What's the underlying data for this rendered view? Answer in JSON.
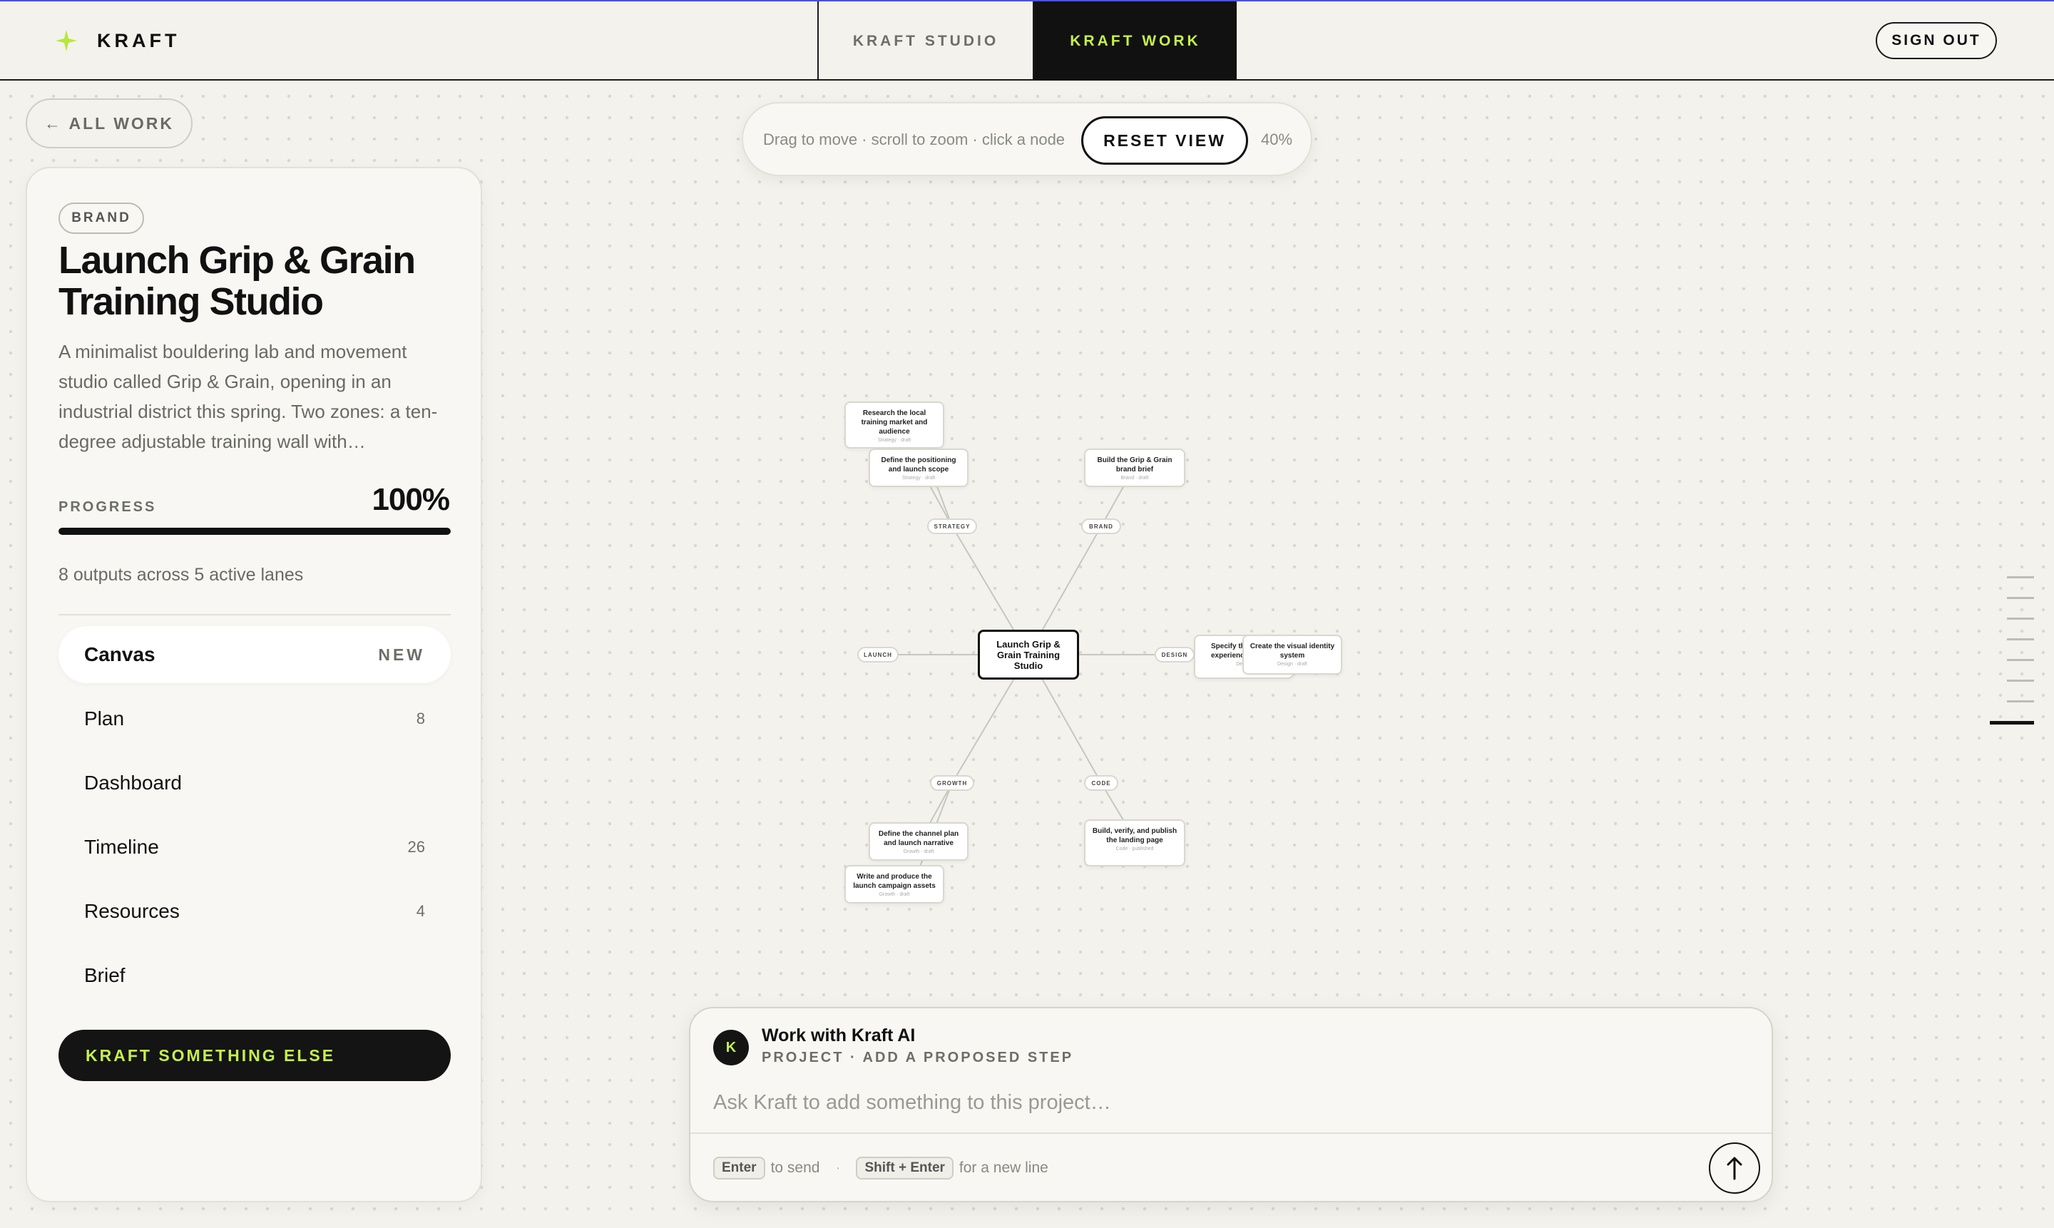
{
  "header": {
    "brand": "KRAFT",
    "tabs": [
      {
        "label": "KRAFT STUDIO",
        "active": false
      },
      {
        "label": "KRAFT WORK",
        "active": true
      }
    ],
    "sign_out": "SIGN OUT"
  },
  "back_link": "← ALL WORK",
  "project": {
    "tag": "BRAND",
    "title": "Launch Grip & Grain Training Studio",
    "description": "A minimalist bouldering lab and movement studio called Grip & Grain, opening in an industrial district this spring. Two zones: a ten-degree adjustable training wall with…",
    "progress_label": "PROGRESS",
    "progress_value": "100%",
    "progress_fraction": 1.0,
    "outputs_summary": "8 outputs across 5 active lanes",
    "nav": [
      {
        "label": "Canvas",
        "badge": "NEW",
        "active": true
      },
      {
        "label": "Plan",
        "count": "8"
      },
      {
        "label": "Dashboard",
        "count": ""
      },
      {
        "label": "Timeline",
        "count": "26"
      },
      {
        "label": "Resources",
        "count": "4"
      },
      {
        "label": "Brief",
        "count": ""
      }
    ],
    "cta": "KRAFT SOMETHING ELSE"
  },
  "toolbar": {
    "hint": "Drag to move · scroll to zoom · click a node",
    "reset": "RESET VIEW",
    "zoom": "40%"
  },
  "canvas": {
    "center": "Launch Grip & Grain Training Studio",
    "lanes": {
      "strategy": "STRATEGY",
      "brand": "BRAND",
      "launch": "LAUNCH",
      "design": "DESIGN",
      "growth": "GROWTH",
      "code": "CODE"
    },
    "nodes": {
      "research": {
        "title": "Research the local training market and audience",
        "sub": "Strategy · draft"
      },
      "positioning": {
        "title": "Define the positioning and launch scope",
        "sub": "Strategy · draft"
      },
      "brand_brief": {
        "title": "Build the Grip & Grain brand brief",
        "sub": "Brand · draft"
      },
      "booking": {
        "title": "Specify the page experience booking",
        "sub": "Design"
      },
      "identity": {
        "title": "Create the visual identity system",
        "sub": "Design · draft"
      },
      "channel": {
        "title": "Define the channel plan and launch narrative",
        "sub": "Growth · draft"
      },
      "campaign": {
        "title": "Write and produce the launch campaign assets",
        "sub": "Growth · draft"
      },
      "landing": {
        "title": "Build, verify, and publish the landing page",
        "sub": "Code · published"
      }
    }
  },
  "composer": {
    "avatar": "K",
    "title": "Work with Kraft AI",
    "subtitle": "PROJECT · ADD A PROPOSED STEP",
    "placeholder": "Ask Kraft to add something to this project…",
    "enter_key": "Enter",
    "enter_hint": "to send",
    "shift_key": "Shift + Enter",
    "shift_hint": "for a new line"
  },
  "colors": {
    "accent": "#c6f04a",
    "ink": "#111111",
    "background": "#f3f2ec"
  }
}
